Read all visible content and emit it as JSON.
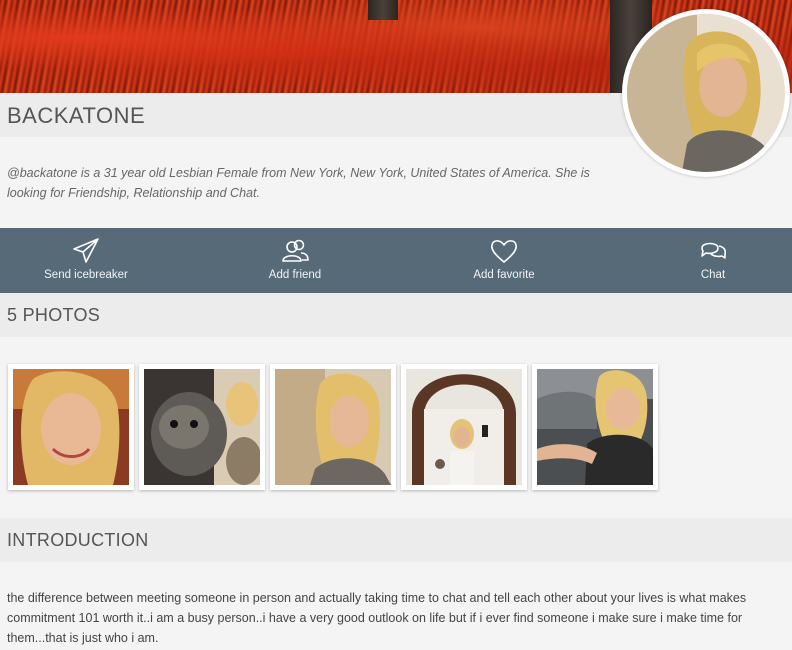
{
  "profile": {
    "username": "BACKATONE",
    "bio": "@backatone is a 31 year old Lesbian Female from New York, New York, United States of America. She is looking for Friendship, Relationship and Chat."
  },
  "actions": [
    {
      "label": "Send icebreaker",
      "icon": "paper-plane-icon"
    },
    {
      "label": "Add friend",
      "icon": "users-icon"
    },
    {
      "label": "Add favorite",
      "icon": "heart-icon"
    },
    {
      "label": "Chat",
      "icon": "chat-bubbles-icon"
    }
  ],
  "photos_section": {
    "title": "5 PHOTOS",
    "photos": [
      {
        "subject": "selfie closeup"
      },
      {
        "subject": "with dog"
      },
      {
        "subject": "portrait"
      },
      {
        "subject": "mirror selfie"
      },
      {
        "subject": "in car"
      }
    ]
  },
  "introduction": {
    "title": "INTRODUCTION",
    "text": "the difference between meeting someone in person and actually taking time to chat and tell each other about your lives is what makes commitment 101 worth it..i am a busy person..i have a very good outlook on life but if i ever find someone i make sure i make time for them...that is just who i am."
  },
  "colors": {
    "action_bar": "#566a78",
    "section_bar": "#ececec",
    "page_bg": "#f4f4f4"
  }
}
